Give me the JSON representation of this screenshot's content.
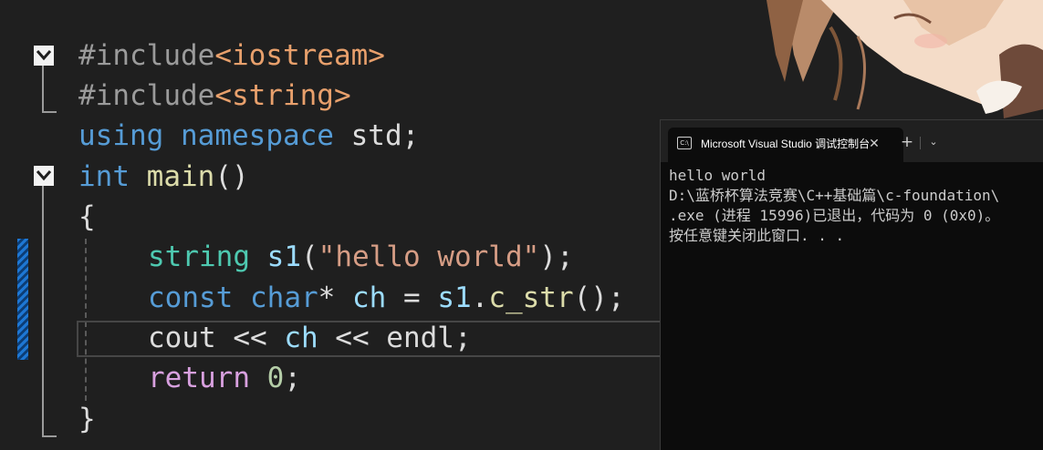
{
  "editor": {
    "lines": [
      {
        "segments": [
          {
            "t": "#include",
            "c": "pp"
          },
          {
            "t": "<iostream>",
            "c": "inc"
          }
        ]
      },
      {
        "segments": [
          {
            "t": "#include",
            "c": "pp"
          },
          {
            "t": "<string>",
            "c": "inc"
          }
        ]
      },
      {
        "segments": [
          {
            "t": "using",
            "c": "kw"
          },
          {
            "t": " ",
            "c": "pl"
          },
          {
            "t": "namespace",
            "c": "kw"
          },
          {
            "t": " std;",
            "c": "pl"
          }
        ]
      },
      {
        "segments": [
          {
            "t": "int",
            "c": "kw"
          },
          {
            "t": " ",
            "c": "pl"
          },
          {
            "t": "main",
            "c": "fn"
          },
          {
            "t": "()",
            "c": "pl"
          }
        ]
      },
      {
        "segments": [
          {
            "t": "{",
            "c": "pl"
          }
        ]
      },
      {
        "segments": [
          {
            "t": "string",
            "c": "ty"
          },
          {
            "t": " ",
            "c": "pl"
          },
          {
            "t": "s1",
            "c": "var"
          },
          {
            "t": "(",
            "c": "pl"
          },
          {
            "t": "\"hello world\"",
            "c": "str"
          },
          {
            "t": ");",
            "c": "pl"
          }
        ]
      },
      {
        "segments": [
          {
            "t": "const",
            "c": "kw"
          },
          {
            "t": " ",
            "c": "pl"
          },
          {
            "t": "char",
            "c": "kw"
          },
          {
            "t": "* ",
            "c": "pl"
          },
          {
            "t": "ch",
            "c": "var"
          },
          {
            "t": " = ",
            "c": "pl"
          },
          {
            "t": "s1",
            "c": "var"
          },
          {
            "t": ".",
            "c": "pl"
          },
          {
            "t": "c_str",
            "c": "fn"
          },
          {
            "t": "();",
            "c": "pl"
          }
        ]
      },
      {
        "segments": [
          {
            "t": "cout",
            "c": "pl"
          },
          {
            "t": " << ",
            "c": "pl"
          },
          {
            "t": "ch",
            "c": "var"
          },
          {
            "t": " << ",
            "c": "pl"
          },
          {
            "t": "endl",
            "c": "pl"
          },
          {
            "t": ";",
            "c": "pl"
          }
        ]
      },
      {
        "segments": [
          {
            "t": "return",
            "c": "ctl"
          },
          {
            "t": " ",
            "c": "pl"
          },
          {
            "t": "0",
            "c": "num"
          },
          {
            "t": ";",
            "c": "pl"
          }
        ]
      },
      {
        "segments": [
          {
            "t": "}",
            "c": "pl"
          }
        ]
      }
    ]
  },
  "terminal": {
    "tab_title": "Microsoft Visual Studio 调试控制台",
    "tab_icon_text": "C:\\",
    "close_glyph": "✕",
    "new_tab_glyph": "+",
    "dropdown_glyph": "⌄",
    "output": [
      "hello world",
      "",
      "D:\\蓝桥杯算法竞赛\\C++基础篇\\c-foundation\\",
      ".exe (进程 15996)已退出，代码为 0 (0x0)。",
      "按任意键关闭此窗口. . ."
    ]
  }
}
